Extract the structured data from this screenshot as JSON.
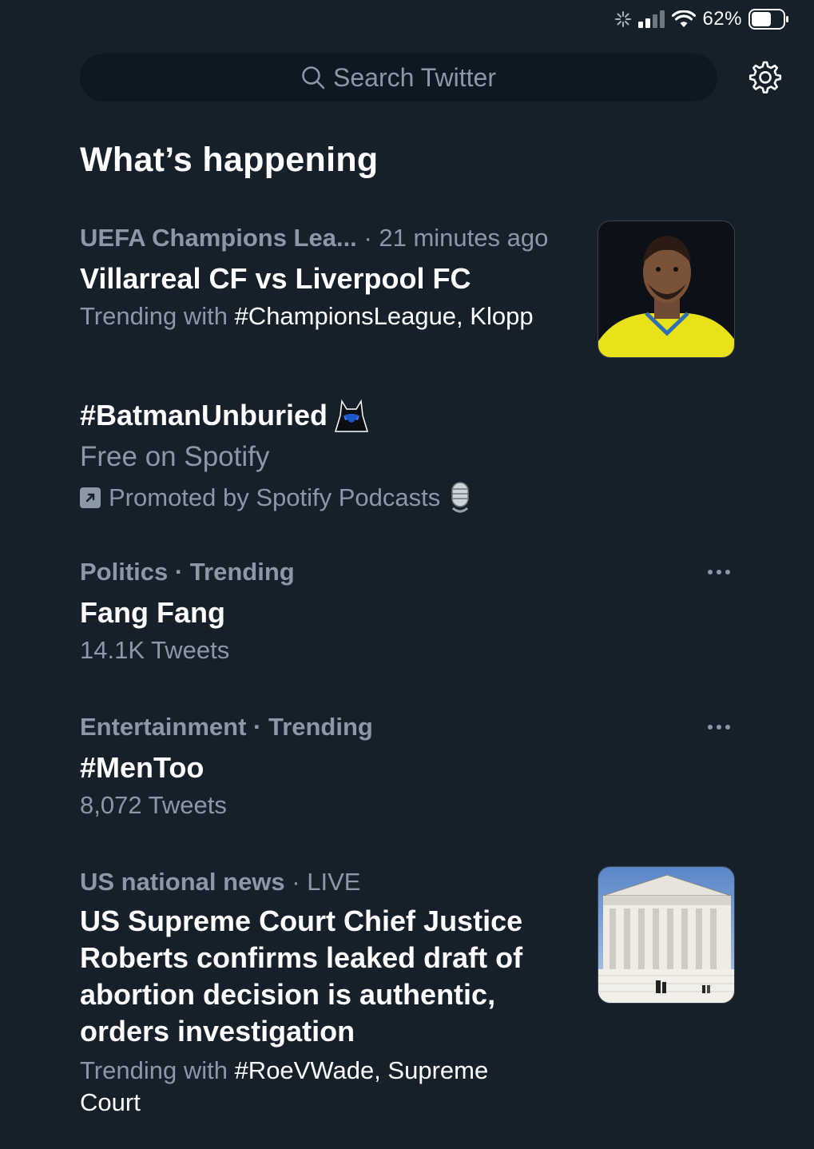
{
  "status_bar": {
    "battery_percent": "62%",
    "battery_level": 0.62
  },
  "search": {
    "placeholder": "Search Twitter"
  },
  "section": {
    "title": "What’s happening"
  },
  "trends": [
    {
      "category": "UEFA Champions Lea...",
      "time": "· 21 minutes ago",
      "headline": "Villarreal CF vs Liverpool FC",
      "sub_prefix": "Trending with ",
      "sub_highlight": "#ChampionsLeague, Klopp"
    },
    {
      "headline": "#BatmanUnburied",
      "sub": "Free on Spotify",
      "promoted": "Promoted by Spotify Podcasts"
    },
    {
      "category": "Politics · Trending",
      "headline": "Fang Fang",
      "count": "14.1K Tweets"
    },
    {
      "category": "Entertainment · Trending",
      "headline": "#MenToo",
      "count": "8,072 Tweets"
    },
    {
      "category": "US national news",
      "time": "· LIVE",
      "headline_lines": [
        "US Supreme Court Chief Justice",
        "Roberts confirms leaked draft of",
        "abortion decision is authentic,",
        "orders investigation"
      ],
      "sub_prefix": "Trending with ",
      "sub_highlight_1": "#RoeVWade, Supreme",
      "sub_highlight_2": "Court"
    }
  ],
  "icons": [
    "search-icon",
    "gear-icon",
    "more-icon",
    "promoted-icon",
    "batman-emoji-icon",
    "microphone-emoji-icon",
    "wifi-icon",
    "signal-icon",
    "battery-icon"
  ]
}
